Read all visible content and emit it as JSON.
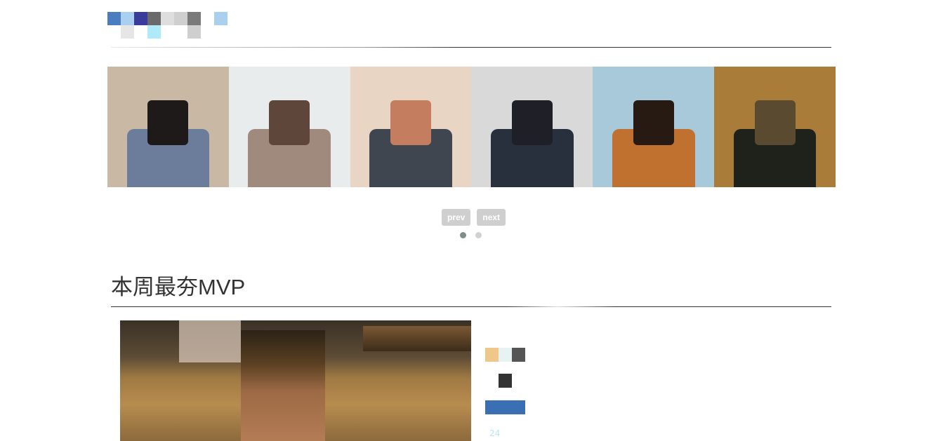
{
  "section_one": {
    "title": "...",
    "colors": {
      "rule": "#333333"
    }
  },
  "gallery": {
    "photos": [
      {
        "alt": "photo-1",
        "bg": "#c9b9a4",
        "face": "#1e1a1a",
        "body": "#6b7d9a"
      },
      {
        "alt": "photo-2",
        "bg": "#e8ecec",
        "face": "#5e463a",
        "body": "#9f8a7d"
      },
      {
        "alt": "photo-3",
        "bg": "#e9d5c3",
        "face": "#c57d60",
        "body": "#3f4650"
      },
      {
        "alt": "photo-4",
        "bg": "#d9d9d9",
        "face": "#1f1f28",
        "body": "#28303e"
      },
      {
        "alt": "photo-5",
        "bg": "#a8c9d9",
        "face": "#261a12",
        "body": "#c0702f"
      },
      {
        "alt": "photo-6",
        "bg": "#a97c3a",
        "face": "#5a4a2f",
        "body": "#1f211b"
      }
    ],
    "prev_label": "prev",
    "next_label": "next",
    "dots": 2,
    "active_dot": 0
  },
  "mvp": {
    "title": "本周最夯MVP",
    "info": [
      {
        "text": "",
        "bg": "#f0c78a"
      },
      {
        "text": "",
        "bg": "#333333"
      },
      {
        "text": "",
        "bg": "#3b6fb3"
      },
      {
        "text": "24",
        "bg": ""
      }
    ]
  }
}
